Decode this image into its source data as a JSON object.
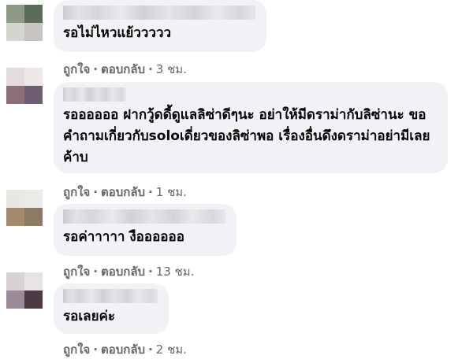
{
  "comments": [
    {
      "text": "รอไม่ไหวแย้ววววว",
      "like_label": "ถูกใจ",
      "reply_label": "ตอบกลับ",
      "time": "3 ชม.",
      "avatar_colors": [
        "#8e9a86",
        "#5c6b59",
        "#d6d4cf",
        "#c9c4bf"
      ]
    },
    {
      "text": "รออออออ ฝากวู้ดดี้ดูแลลิซ่าดีๆนะ อย่าให้มีดราม่ากับลิซ่านะ ขอ\nคำถามเกี่ยวกับsoloเดี่ยวของลิซ่าพอ เรื่องอื่นดึงดราม่าอย่ามีเลย\nค้าบ",
      "like_label": "ถูกใจ",
      "reply_label": "ตอบกลับ",
      "time": "1 ชม.",
      "avatar_colors": [
        "#e3dcdc",
        "#ede7e7",
        "#8a6f76",
        "#6e5d72"
      ]
    },
    {
      "text": "รอค่าาาาา งืออออออ",
      "like_label": "ถูกใจ",
      "reply_label": "ตอบกลับ",
      "time": "13 ชม.",
      "avatar_colors": [
        "#e9e7e2",
        "#ecebe7",
        "#a38a6c",
        "#8b7a64"
      ]
    },
    {
      "text": "รอเลยค่ะ",
      "like_label": "ถูกใจ",
      "reply_label": "ตอบกลับ",
      "time": "2 ชม.",
      "avatar_colors": [
        "#d8d2d6",
        "#e7e3e6",
        "#9b8a97",
        "#4c3a44"
      ]
    }
  ]
}
